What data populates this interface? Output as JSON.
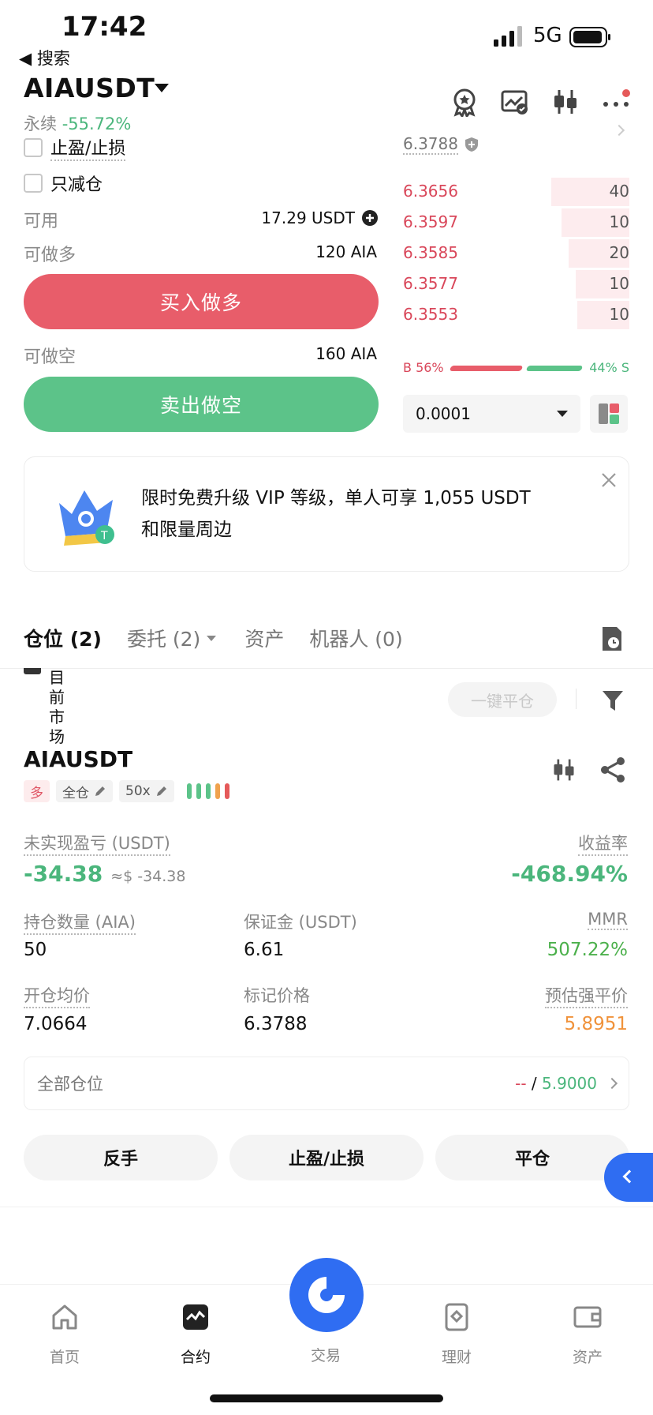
{
  "status_bar": {
    "time": "17:42",
    "back_label": "◀ 搜索",
    "network": "5G"
  },
  "header": {
    "symbol": "AIAUSDT",
    "contract_type": "永续",
    "change_pct": "-55.72%",
    "icons": [
      "badge-icon",
      "chart-check-icon",
      "candlestick-icon",
      "more-icon"
    ]
  },
  "form": {
    "tp_sl_label": "止盈/止损",
    "reduce_only_label": "只减仓",
    "available_label": "可用",
    "available_value": "17.29 USDT",
    "long_avail_label": "可做多",
    "long_avail_value": "120 AIA",
    "buy_label": "买入做多",
    "short_avail_label": "可做空",
    "short_avail_value": "160 AIA",
    "sell_label": "卖出做空"
  },
  "orderbook": {
    "mark_price": "6.3788",
    "asks": [
      {
        "price": "6.3656",
        "qty": "40",
        "depth": 0.9
      },
      {
        "price": "6.3597",
        "qty": "10",
        "depth": 0.78
      },
      {
        "price": "6.3585",
        "qty": "20",
        "depth": 0.7
      },
      {
        "price": "6.3577",
        "qty": "10",
        "depth": 0.62
      },
      {
        "price": "6.3553",
        "qty": "10",
        "depth": 0.6
      }
    ],
    "buy_ratio_label": "B 56%",
    "sell_ratio_label": "44% S",
    "buy_ratio": 0.56,
    "precision": "0.0001"
  },
  "banner": {
    "line1": "限时免费升级 VIP 等级，单人可享 1,055 USDT",
    "line2": "和限量周边"
  },
  "tabs": {
    "positions": "仓位 (2)",
    "orders": "委托 (2)",
    "assets": "资产",
    "bots": "机器人 (0)"
  },
  "filter": {
    "current_market": "目前市场",
    "close_all": "一键平仓"
  },
  "position": {
    "symbol": "AIAUSDT",
    "side_tag": "多",
    "margin_mode": "全仓",
    "leverage": "50x",
    "upnl_label": "未实现盈亏 (USDT)",
    "upnl_value": "-34.38",
    "upnl_usd": "≈$ -34.38",
    "roe_label": "收益率",
    "roe_value": "-468.94%",
    "size_label": "持仓数量 (AIA)",
    "size_value": "50",
    "margin_label": "保证金 (USDT)",
    "margin_value": "6.61",
    "mmr_label": "MMR",
    "mmr_value": "507.22%",
    "entry_label": "开仓均价",
    "entry_value": "7.0664",
    "mark_label": "标记价格",
    "mark_value": "6.3788",
    "liq_label": "预估强平价",
    "liq_value": "5.8951",
    "all_pos_label": "全部仓位",
    "all_pos_dash": "--",
    "all_pos_sep": " / ",
    "all_pos_price": "5.9000",
    "reverse_label": "反手",
    "tpsl_label": "止盈/止损",
    "close_label": "平仓"
  },
  "nav": {
    "home": "首页",
    "contract": "合约",
    "trade": "交易",
    "finance": "理财",
    "assets": "资产"
  },
  "colors": {
    "red": "#e85d6a",
    "green": "#5cc389",
    "blue": "#2f6df2"
  }
}
